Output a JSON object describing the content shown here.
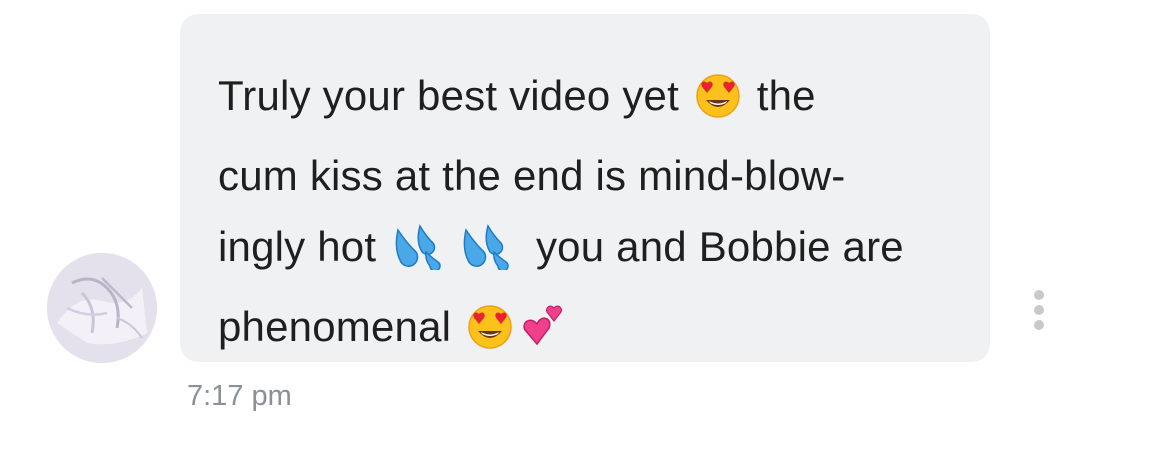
{
  "message": {
    "lines": [
      {
        "before": "Truly your best video yet",
        "after": "the"
      },
      {
        "text": "cum kiss at the end is mind-blow-"
      },
      {
        "before": "ingly hot",
        "after": "you and Bobbie are"
      },
      {
        "text": "phenomenal"
      }
    ],
    "emojis": [
      "heart-eyes-face",
      "sweat-droplets",
      "sweat-droplets",
      "heart-eyes-face",
      "two-hearts"
    ],
    "timestamp": "7:17 pm"
  },
  "colors": {
    "bubble": "#f0f1f3",
    "text": "#1f1f1f",
    "timestamp": "#8a8f98",
    "menu_dots": "#c7c9cd"
  },
  "icons": {
    "more_menu": "more-vertical-icon",
    "avatar": "avatar-image"
  }
}
